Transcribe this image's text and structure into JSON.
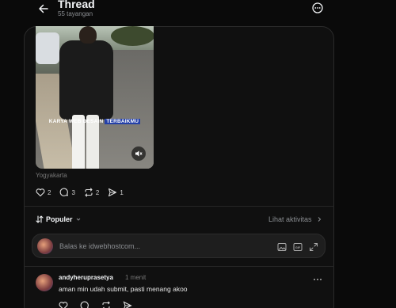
{
  "header": {
    "title": "Thread",
    "views": "55 tayangan"
  },
  "post": {
    "video_caption_plain": "KARYA WEB DESAIN",
    "video_caption_highlight": "TERBAIKMU",
    "location": "Yogyakarta",
    "stats": {
      "likes": "2",
      "comments": "3",
      "reposts": "2",
      "shares": "1"
    }
  },
  "sort": {
    "label": "Populer",
    "activity_label": "Lihat aktivitas"
  },
  "reply": {
    "placeholder": "Balas ke idwebhostcom..."
  },
  "comment": {
    "username": "andyheruprasetya",
    "time": "1 menit",
    "text": "aman min udah submit, pasti menang akoo"
  },
  "colors": {
    "background": "#0a0a0a",
    "card": "#101010",
    "caption_highlight": "#2440a8"
  },
  "icons": [
    "back-arrow-icon",
    "more-icon",
    "volume-muted-icon",
    "heart-icon",
    "comment-icon",
    "repost-icon",
    "share-icon",
    "sort-icon",
    "chevron-down-icon",
    "chevron-right-icon",
    "image-icon",
    "gif-icon",
    "expand-icon",
    "more-dots-icon"
  ]
}
